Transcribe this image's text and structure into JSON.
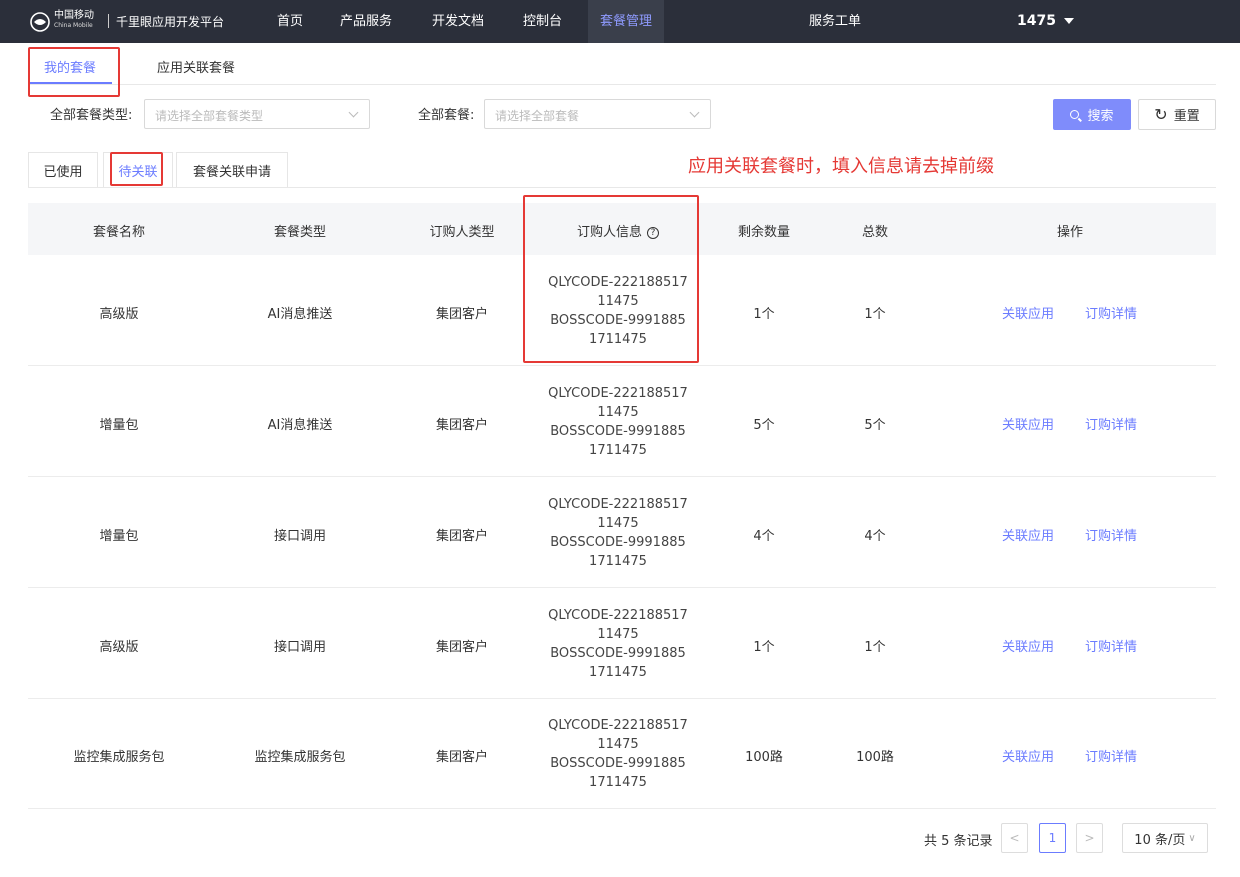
{
  "header": {
    "brand_cn": "中国移动",
    "brand_en": "China Mobile",
    "platform": "千里眼应用开发平台",
    "nav": [
      "首页",
      "产品服务",
      "开发文档",
      "控制台",
      "套餐管理"
    ],
    "service": "服务工单",
    "user": "1475",
    "accent_color": "#8f9bff"
  },
  "main_tabs": [
    "我的套餐",
    "应用关联套餐"
  ],
  "filters": {
    "type_label": "全部套餐类型:",
    "type_placeholder": "请选择全部套餐类型",
    "pkg_label": "全部套餐:",
    "pkg_placeholder": "请选择全部套餐",
    "search": "搜索",
    "reset": "重置"
  },
  "status_tabs": [
    "已使用",
    "待关联",
    "套餐关联申请"
  ],
  "note": "应用关联套餐时，填入信息请去掉前缀",
  "table": {
    "headers": [
      "套餐名称",
      "套餐类型",
      "订购人类型",
      "订购人信息",
      "剩余数量",
      "总数",
      "操作"
    ],
    "rows": [
      {
        "name": "高级版",
        "type": "AI消息推送",
        "buyer": "集团客户",
        "info": [
          "QLYCODE-222188517",
          "11475",
          "BOSSCODE-9991885",
          "1711475"
        ],
        "remain": "1个",
        "total": "1个",
        "op1": "关联应用",
        "op2": "订购详情"
      },
      {
        "name": "增量包",
        "type": "AI消息推送",
        "buyer": "集团客户",
        "info": [
          "QLYCODE-222188517",
          "11475",
          "BOSSCODE-9991885",
          "1711475"
        ],
        "remain": "5个",
        "total": "5个",
        "op1": "关联应用",
        "op2": "订购详情"
      },
      {
        "name": "增量包",
        "type": "接口调用",
        "buyer": "集团客户",
        "info": [
          "QLYCODE-222188517",
          "11475",
          "BOSSCODE-9991885",
          "1711475"
        ],
        "remain": "4个",
        "total": "4个",
        "op1": "关联应用",
        "op2": "订购详情"
      },
      {
        "name": "高级版",
        "type": "接口调用",
        "buyer": "集团客户",
        "info": [
          "QLYCODE-222188517",
          "11475",
          "BOSSCODE-9991885",
          "1711475"
        ],
        "remain": "1个",
        "total": "1个",
        "op1": "关联应用",
        "op2": "订购详情"
      },
      {
        "name": "监控集成服务包",
        "type": "监控集成服务包",
        "buyer": "集团客户",
        "info": [
          "QLYCODE-222188517",
          "11475",
          "BOSSCODE-9991885",
          "1711475"
        ],
        "remain": "100路",
        "total": "100路",
        "op1": "关联应用",
        "op2": "订购详情"
      }
    ]
  },
  "pagination": {
    "total_text": "共 5 条记录",
    "prev": "<",
    "page": "1",
    "next": ">",
    "page_size": "10 条/页"
  }
}
